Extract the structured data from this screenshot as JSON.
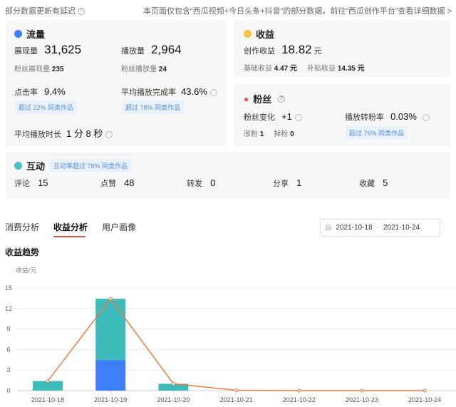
{
  "header": {
    "delay_note": "部分数据更新有延迟",
    "info_note": "本页面仅包含“西瓜视频+今日头条+抖音”的部分数据，前往“西瓜创作平台”查看详细数据 >"
  },
  "traffic": {
    "title": "流量",
    "impressions_label": "展现量",
    "impressions": "31,625",
    "fan_impressions_label": "粉丝展现量",
    "fan_impressions": "235",
    "plays_label": "播放量",
    "plays": "2,964",
    "fan_plays_label": "粉丝播放量",
    "fan_plays": "24",
    "ctr_label": "点击率",
    "ctr": "9.4%",
    "ctr_tag": "超过 22% 同类作品",
    "completion_label": "平均播放完成率",
    "completion": "43.6%",
    "completion_tag": "超过 78% 同类作品",
    "avg_duration_label": "平均播放时长",
    "avg_duration": "1 分 8 秒"
  },
  "income": {
    "title": "收益",
    "creation_label": "创作收益",
    "creation": "18.82",
    "unit": "元",
    "base_label": "基础收益",
    "base": "4.47 元",
    "subsidy_label": "补贴收益",
    "subsidy": "14.35 元"
  },
  "fans": {
    "title": "粉丝",
    "change_label": "粉丝变化",
    "change": "+1",
    "gain_label": "涨粉",
    "gain": "1",
    "loss_label": "掉粉",
    "loss": "0",
    "conv_label": "播放转粉率",
    "conv": "0.03%",
    "conv_tag": "超过 76% 同类作品"
  },
  "interaction": {
    "title": "互动",
    "tag": "互动率超过 78% 同类作品",
    "items": [
      {
        "label": "评论",
        "value": "15"
      },
      {
        "label": "点赞",
        "value": "48"
      },
      {
        "label": "转发",
        "value": "0"
      },
      {
        "label": "分享",
        "value": "1"
      },
      {
        "label": "收藏",
        "value": "5"
      }
    ]
  },
  "tabs": [
    {
      "label": "消费分析"
    },
    {
      "label": "收益分析"
    },
    {
      "label": "用户画像"
    }
  ],
  "date_range": {
    "start": "2021-10-18",
    "sep": "-",
    "end": "2021-10-24"
  },
  "section_title": "收益趋势",
  "colors": {
    "base": "#3e7ff7",
    "subsidy": "#3dbcbb",
    "total": "#f07b3f",
    "accent": "#e0574f"
  },
  "chart_data": {
    "type": "bar",
    "stacked": true,
    "ylabel": "收益/元",
    "ylim": [
      0,
      15
    ],
    "yticks": [
      0,
      3,
      6,
      9,
      12,
      15
    ],
    "categories": [
      "2021-10-18",
      "2021-10-19",
      "2021-10-20",
      "2021-10-21",
      "2021-10-22",
      "2021-10-23",
      "2021-10-24"
    ],
    "series": [
      {
        "name": "基础收益",
        "type": "bar",
        "values": [
          0,
          4.47,
          0,
          0,
          0,
          0,
          0
        ]
      },
      {
        "name": "补贴收益",
        "type": "bar",
        "values": [
          1.4,
          8.95,
          1.0,
          0,
          0,
          0,
          0
        ]
      },
      {
        "name": "创作收益",
        "type": "line",
        "values": [
          1.4,
          13.42,
          1.0,
          0.05,
          0,
          0,
          0
        ]
      }
    ]
  }
}
